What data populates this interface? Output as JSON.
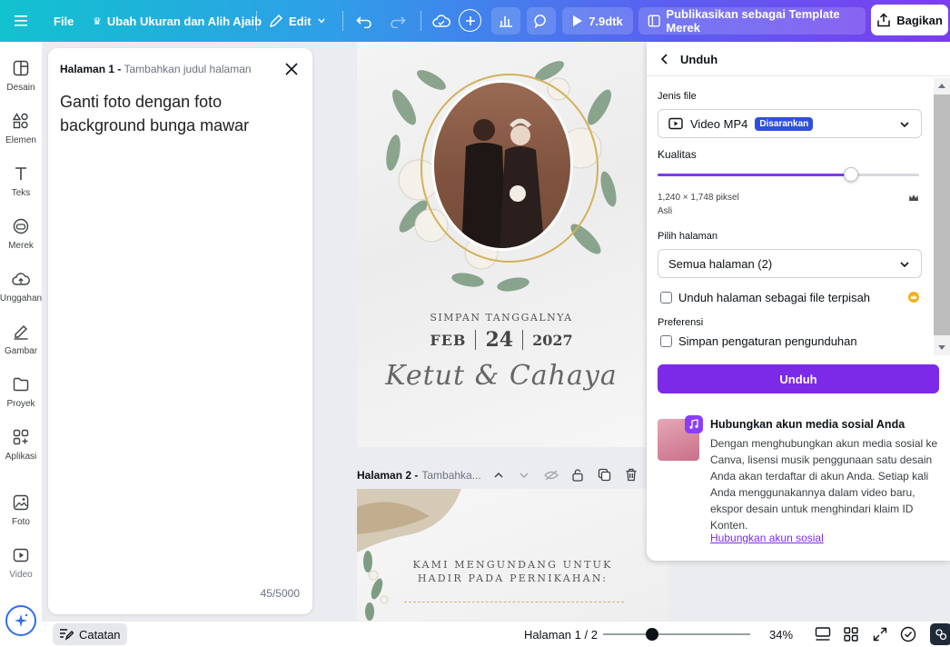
{
  "topbar": {
    "file_label": "File",
    "resize_label": "Ubah Ukuran dan Alih Ajaib",
    "edit_label": "Edit",
    "duration_label": "7.9dtk",
    "publish_label": "Publikasikan sebagai Template Merek",
    "share_label": "Bagikan"
  },
  "rail": {
    "items": [
      {
        "label": "Desain"
      },
      {
        "label": "Elemen"
      },
      {
        "label": "Teks"
      },
      {
        "label": "Merek"
      },
      {
        "label": "Unggahan"
      },
      {
        "label": "Gambar"
      },
      {
        "label": "Proyek"
      },
      {
        "label": "Aplikasi"
      },
      {
        "label": "Foto"
      },
      {
        "label": "Video"
      }
    ]
  },
  "notes": {
    "page_label": "Halaman 1 -",
    "page_sub": "Tambahkan judul halaman",
    "text": "Ganti foto dengan foto background bunga mawar",
    "count": "45/5000"
  },
  "canvas": {
    "save_date": "SIMPAN TANGGALNYA",
    "month": "FEB",
    "day": "24",
    "year": "2027",
    "names": "Ketut & Cahaya",
    "page2_label": "Halaman 2 -",
    "page2_sub": "Tambahka...",
    "invite_line1": "KAMI MENGUNDANG UNTUK",
    "invite_line2": "HADIR PADA PERNIKAHAN:"
  },
  "download": {
    "title": "Unduh",
    "file_type_label": "Jenis file",
    "file_type_value": "Video MP4",
    "recommended_badge": "Disarankan",
    "quality_label": "Kualitas",
    "quality_fraction": 0.74,
    "dimensions": "1,240 × 1,748 piksel",
    "original": "Asli",
    "pages_label": "Pilih halaman",
    "pages_value": "Semua halaman (2)",
    "separate_files_label": "Unduh halaman sebagai file terpisah",
    "preferences_label": "Preferensi",
    "save_settings_label": "Simpan pengaturan pengunduhan",
    "download_button": "Unduh",
    "social_title": "Hubungkan akun media sosial Anda",
    "social_body": "Dengan menghubungkan akun media sosial ke Canva, lisensi musik penggunaan satu desain Anda akan terdaftar di akun Anda. Setiap kali Anda menggunakannya dalam video baru, ekspor desain untuk menghindari klaim ID Konten.",
    "social_link": "Hubungkan akun sosial"
  },
  "bottombar": {
    "notes_label": "Catatan",
    "page_indicator": "Halaman 1 / 2",
    "zoom": "34%",
    "zoom_fraction": 0.34
  },
  "colors": {
    "accent": "#7d2ae8",
    "badge": "#2f4fdb"
  }
}
